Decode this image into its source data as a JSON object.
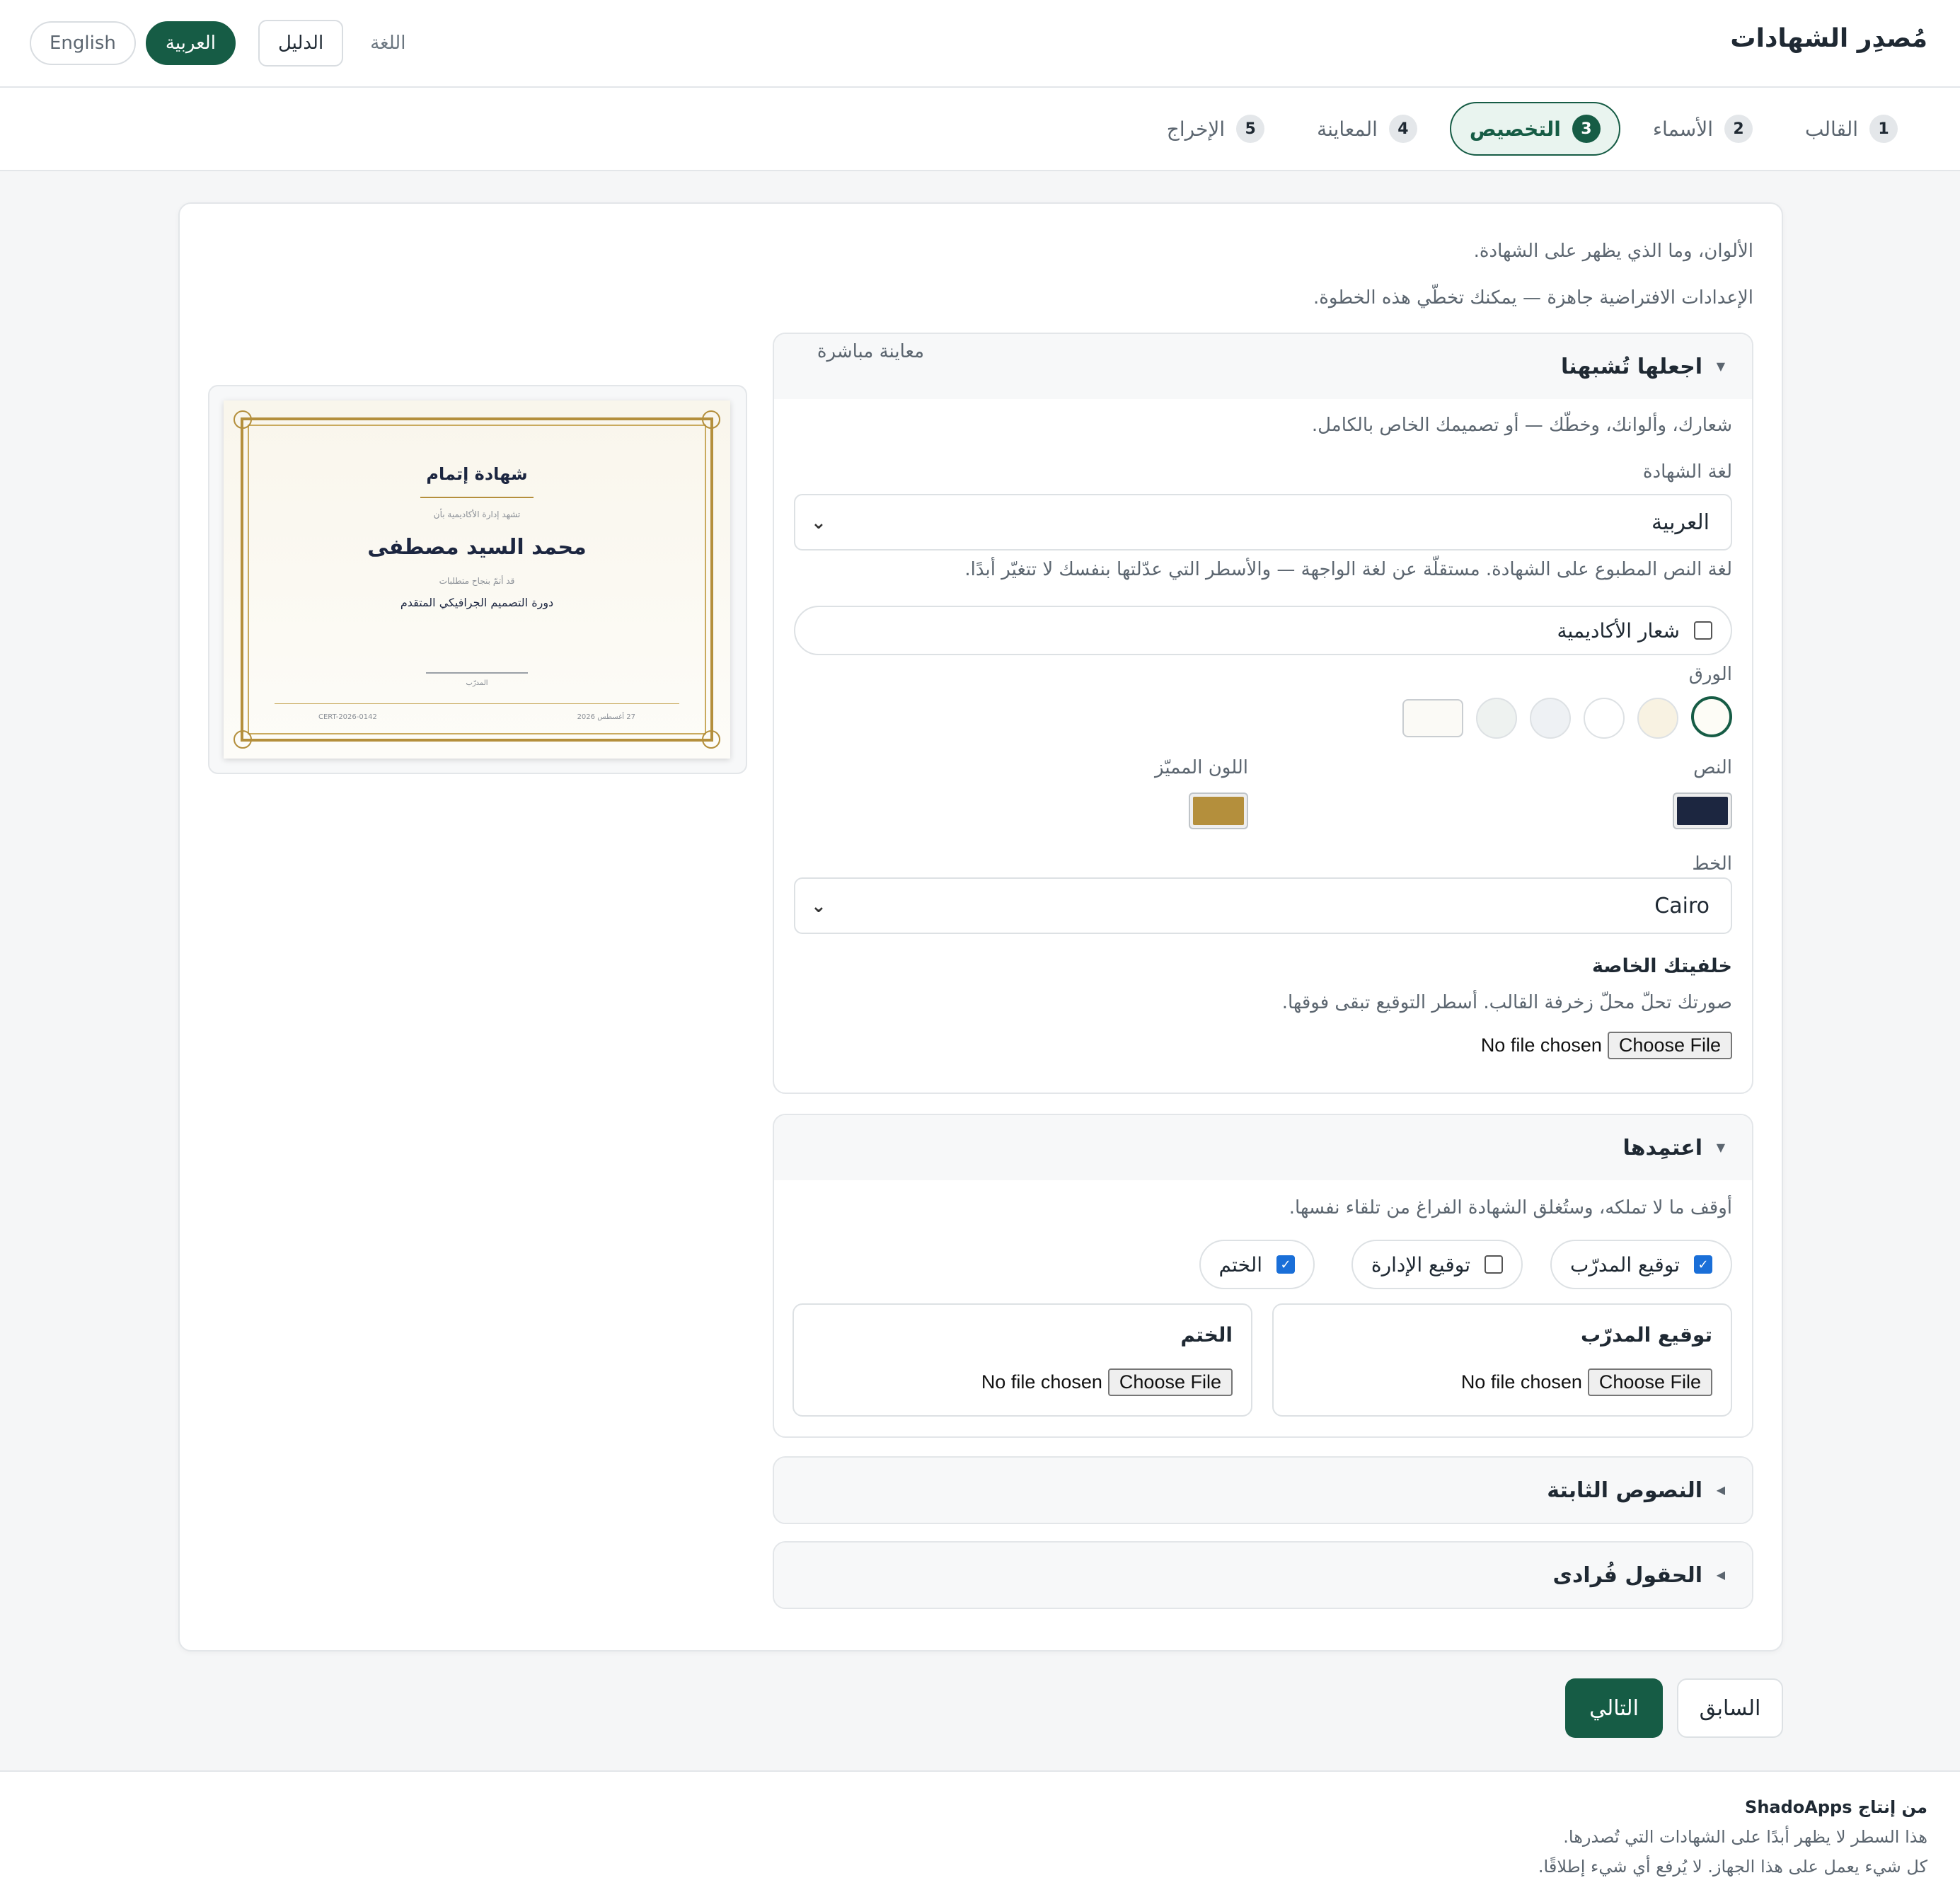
{
  "header": {
    "app_title": "مُصدِر الشهادات",
    "lang_label": "اللغة",
    "guide_label": "الدليل",
    "lang_options": [
      "العربية",
      "English"
    ],
    "lang_selected": "العربية"
  },
  "steps": [
    {
      "num": "1",
      "label": "القالب",
      "active": false
    },
    {
      "num": "2",
      "label": "الأسماء",
      "active": false
    },
    {
      "num": "3",
      "label": "التخصيص",
      "active": true
    },
    {
      "num": "4",
      "label": "المعاينة",
      "active": false
    },
    {
      "num": "5",
      "label": "الإخراج",
      "active": false
    }
  ],
  "intro": {
    "line1": "الألوان، وما الذي يظهر على الشهادة.",
    "line2": "الإعدادات الافتراضية جاهزة — يمكنك تخطّي هذه الخطوة."
  },
  "section_brand": {
    "title": "اجعلها تُشبهنا",
    "description": "شعارك، وألوانك، وخطّك — أو تصميمك الخاص بالكامل.",
    "cert_lang_label": "لغة الشهادة",
    "cert_lang_value": "العربية",
    "cert_lang_help": "لغة النص المطبوع على الشهادة. مستقلّة عن لغة الواجهة — والأسطر التي عدّلتها بنفسك لا تتغيّر أبدًا.",
    "logo_checkbox_label": "شعار الأكاديمية",
    "logo_checked": false,
    "paper_label": "الورق",
    "paper_swatches": [
      "#fdfcf6",
      "#f8f2e2",
      "#ffffff",
      "#eef1f4",
      "#eef2f0",
      "#fbfaf6"
    ],
    "text_color_label": "النص",
    "text_color": "#1c2640",
    "accent_color_label": "اللون المميّز",
    "accent_color": "#b48f3c",
    "font_label": "الخط",
    "font_value": "Cairo",
    "bg_title": "خلفيتك الخاصة",
    "bg_help": "صورتك تحلّ محلّ زخرفة القالب. أسطر التوقيع تبقى فوقها.",
    "file_button": "Choose File",
    "file_status": "No file chosen"
  },
  "section_approve": {
    "title": "اعتمِدها",
    "description": "أوقف ما لا تملكه، وستُغلق الشهادة الفراغ من تلقاء نفسها.",
    "chips": [
      {
        "label": "توقيع المدرّب",
        "checked": true
      },
      {
        "label": "توقيع الإدارة",
        "checked": false
      },
      {
        "label": "الختم",
        "checked": true
      }
    ],
    "upload_trainer_title": "توقيع المدرّب",
    "upload_seal_title": "الختم",
    "file_button": "Choose File",
    "file_status": "No file chosen"
  },
  "section_texts": {
    "title": "النصوص الثابتة"
  },
  "section_fields": {
    "title": "الحقول فُرادى"
  },
  "preview": {
    "label": "معاينة مباشرة",
    "cert_title": "شهادة إتمام",
    "cert_intro": "تشهد إدارة الأكاديمية بأن",
    "cert_name": "محمد السيد مصطفى",
    "cert_completed": "قد أتمّ بنجاح متطلبات",
    "cert_course": "دورة التصميم الجرافيكي المتقدم",
    "cert_signer": "المدرّب",
    "cert_id": "CERT-2026-0142",
    "cert_date": "27 أغسطس 2026"
  },
  "nav": {
    "prev_label": "السابق",
    "next_label": "التالي"
  },
  "footer": {
    "brand": "من إنتاج ShadoApps",
    "line1": "هذا السطر لا يظهر أبدًا على الشهادات التي تُصدرها.",
    "line2": "كل شيء يعمل على هذا الجهاز. لا يُرفع أي شيء إطلاقًا."
  }
}
